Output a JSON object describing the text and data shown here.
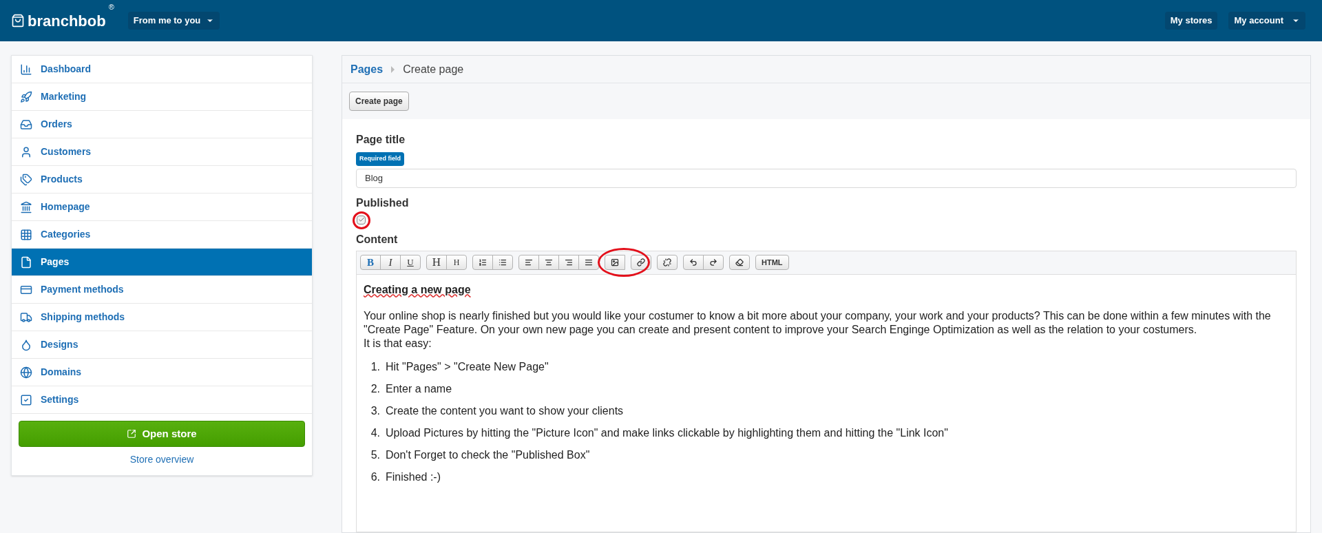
{
  "header": {
    "logo": "branchbob",
    "registered": "®",
    "store_menu": "From me to you",
    "links": [
      {
        "label": "My stores",
        "dropdown": false
      },
      {
        "label": "My account",
        "dropdown": true
      }
    ]
  },
  "sidebar": {
    "items": [
      {
        "label": "Dashboard",
        "selected": false
      },
      {
        "label": "Marketing",
        "selected": false
      },
      {
        "label": "Orders",
        "selected": false
      },
      {
        "label": "Customers",
        "selected": false
      },
      {
        "label": "Products",
        "selected": false
      },
      {
        "label": "Homepage",
        "selected": false
      },
      {
        "label": "Categories",
        "selected": false
      },
      {
        "label": "Pages",
        "selected": true
      },
      {
        "label": "Payment methods",
        "selected": false
      },
      {
        "label": "Shipping methods",
        "selected": false
      },
      {
        "label": "Designs",
        "selected": false
      },
      {
        "label": "Domains",
        "selected": false
      },
      {
        "label": "Settings",
        "selected": false
      }
    ],
    "open_store": "Open store",
    "store_overview": "Store overview"
  },
  "breadcrumb": [
    "Pages",
    "Create page"
  ],
  "action_button": "Create page",
  "form": {
    "title_label": "Page title",
    "required_badge": "Required field",
    "title_value": "Blog",
    "published_label": "Published",
    "published_checked": true,
    "content_label": "Content"
  },
  "editor": {
    "toolbar": [
      [
        {
          "kind": "bold",
          "label": "B"
        },
        {
          "kind": "italic",
          "label": "I"
        },
        {
          "kind": "underline",
          "label": "U"
        }
      ],
      [
        {
          "kind": "h1",
          "label": "H"
        },
        {
          "kind": "h2",
          "label": "H"
        }
      ],
      [
        {
          "kind": "olist"
        },
        {
          "kind": "ulist"
        }
      ],
      [
        {
          "kind": "alignleft"
        },
        {
          "kind": "aligncenter"
        },
        {
          "kind": "alignright"
        },
        {
          "kind": "justify"
        }
      ],
      [
        {
          "kind": "image"
        }
      ],
      [
        {
          "kind": "link"
        }
      ],
      [
        {
          "kind": "unlink"
        }
      ],
      [
        {
          "kind": "undo"
        },
        {
          "kind": "redo"
        }
      ],
      [
        {
          "kind": "eraser"
        }
      ],
      [
        {
          "kind": "html",
          "label": "HTML"
        }
      ]
    ],
    "heading": "Creating a new page",
    "paragraph": "Your online shop is nearly finished but you would like your costumer to know a bit more about your company, your work and your products? This can be done within a few minutes with the \"Create Page\" Feature. On your own new page you can create and present content to improve your Search Enginge Optimization as well as the relation to your costumers.",
    "intro": "It is that easy:",
    "steps": [
      {
        "number": "1.",
        "text": "Hit \"Pages\" > \"Create New Page\""
      },
      {
        "number": "2.",
        "text": "Enter a name"
      },
      {
        "number": "3.",
        "text": "Create the content you want to show your clients"
      },
      {
        "number": "4.",
        "text": "Upload Pictures by hitting the \"Picture Icon\" and make links clickable by highlighting them and hitting the \"Link Icon\""
      },
      {
        "number": "5.",
        "text": "Don't Forget to check the \"Published Box\""
      },
      {
        "number": "6.",
        "text": "Finished :-)"
      }
    ]
  }
}
